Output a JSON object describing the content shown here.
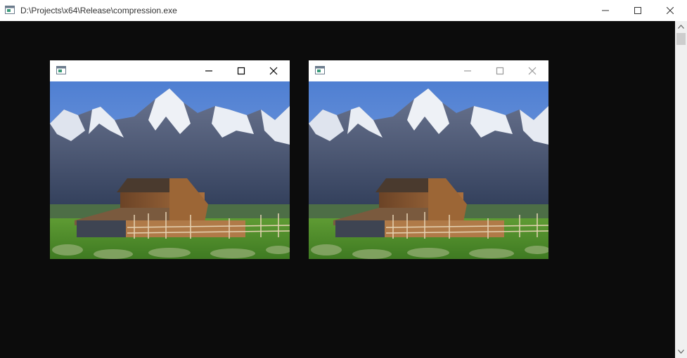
{
  "window": {
    "title": "D:\\Projects\\x64\\Release\\compression.exe",
    "minimize_icon": "minimize-icon",
    "maximize_icon": "maximize-icon",
    "close_icon": "close-icon"
  },
  "console": {
    "background": "#0c0c0c"
  },
  "image_windows": [
    {
      "id": "original",
      "active": true,
      "content": "barn-mountains-photo"
    },
    {
      "id": "compressed",
      "active": false,
      "content": "barn-mountains-photo"
    }
  ],
  "colors": {
    "sky": "#5a86d6",
    "mountain": "#4a5a78",
    "snow": "#f2f4f8",
    "grass": "#4f8a2a",
    "barn": "#8a5a34"
  }
}
